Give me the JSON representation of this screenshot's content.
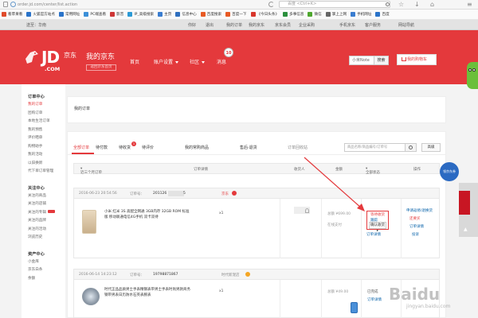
{
  "browser": {
    "url": "order.jd.com/center/list.action",
    "search_placeholder": "百度 <Ctrl+K>",
    "bookmarks": [
      {
        "label": "看苹果看",
        "color": "#e04b2b"
      },
      {
        "label": "火狐官方站点",
        "color": "#2a73c9"
      },
      {
        "label": "常用网址",
        "color": "#2a73c9"
      },
      {
        "label": "PC端查看",
        "color": "#3b8fd8"
      },
      {
        "label": "影音",
        "color": "#ce3636"
      },
      {
        "label": "IP_高级搜索",
        "color": "#2c9ad6"
      },
      {
        "label": "主页",
        "color": "#3a7dd0"
      },
      {
        "label": "信息中心",
        "color": "#2f6fbf"
      },
      {
        "label": "百度搜索",
        "color": "#e85a24"
      },
      {
        "label": "百度一下",
        "color": "#e85a24"
      },
      {
        "label": "《今日头条》",
        "color": "#d8362c"
      },
      {
        "label": "多事信息",
        "color": "#2a8f3c"
      },
      {
        "label": "微信",
        "color": "#4ea72e"
      },
      {
        "label": "掌上上网",
        "color": "#666666"
      },
      {
        "label": "手机网址",
        "color": "#3a7dd0"
      },
      {
        "label": "百度",
        "color": "#2a73c9"
      }
    ]
  },
  "shortcut": {
    "location": "送至：华南",
    "user": "你好",
    "logout": "退出",
    "my_orders": "我的订单",
    "my_jd": "我的京东",
    "jd_member": "京东会员",
    "enterprise": "企业采购",
    "service": "客户服务",
    "site_nav": "网站导航",
    "mobile_jd": "手机京东"
  },
  "header": {
    "logo_text": "JD",
    "logo_com": ".COM",
    "jd_cn": "京东",
    "my_jd": "我的京东",
    "back_home": "返回京东首页",
    "nav_home": "首页",
    "nav_settings": "账户设置",
    "nav_community": "社区",
    "nav_messages": "消息",
    "message_count": "10",
    "search_value": "小米Note",
    "search_btn": "搜索",
    "cart_btn": "我的购物车"
  },
  "sidebar": {
    "sections": [
      {
        "title": "订单中心",
        "items": [
          "我的订单",
          "团购订单",
          "本地生活订单",
          "我的预售",
          "评价晒单",
          "购物助手",
          "我的活动",
          "以旧换新",
          "代下单订单管理"
        ]
      },
      {
        "title": "关注中心",
        "items": [
          "关注的商品",
          "关注的店铺",
          "关注的专辑",
          "关注的品牌",
          "关注的活动",
          "浏览历史"
        ]
      },
      {
        "title": "资产中心",
        "items": [
          "小金库",
          "京东白条",
          "余额"
        ]
      }
    ],
    "hot_badge_items": [
      "关注的专辑"
    ]
  },
  "breadcrumb": {
    "text": "我的订单"
  },
  "tabs": {
    "items": [
      "全部订单",
      "待付款",
      "待收货",
      "待评价"
    ],
    "pending_receive_count": "1",
    "service_tab": "我的常购商品",
    "welfare_tab": "售后·退货",
    "recycle_tab": "订单回收站",
    "search_placeholder": "商品名称/商品编号/订单号",
    "search_icon": "search-icon",
    "advanced": "高级"
  },
  "table_header": {
    "range": "近三个月订单",
    "details": "订单详情",
    "receiver": "收货人",
    "amount": "金额",
    "status": "全部状态",
    "ops": "操作"
  },
  "orders": [
    {
      "date": "2016-06-23 20:54:56",
      "number_label": "订单号：",
      "number": "201126",
      "number_tail": "5",
      "shop": "京东",
      "title": "小米 红米 3S 高配全网通 3GB内存 32GB ROM 标准版 移动联通电信4G手机 双卡双待",
      "qty": "x1",
      "receiver": "",
      "amount_total": "总额 ¥699.00",
      "amount_pay": "在线支付",
      "status": "等待收货",
      "status_link": "跟踪",
      "status_detail": "订单详情",
      "op_confirm": "确认收货",
      "op_buy_again": "立即购买",
      "op_service": "申请返修/退换货",
      "op_comment": "还要买",
      "op_apply": "投诉"
    },
    {
      "date": "2016-06-14 14:23:12",
      "number_label": "订单号：",
      "number": "19798871867",
      "shop": "时代新宠店",
      "title": "时代正品品质男士手表精钢表带男士手表时尚男款商务钢带男表日历防水石英表腕表",
      "qty": "x1",
      "amount_total": "总额 ¥49.00",
      "status": "已完成",
      "status_detail": "订单详情"
    }
  ],
  "float": {
    "coupon": "领京东券",
    "watermark": "Baidu",
    "watermark_sub": "jingyan.baidu.com"
  }
}
